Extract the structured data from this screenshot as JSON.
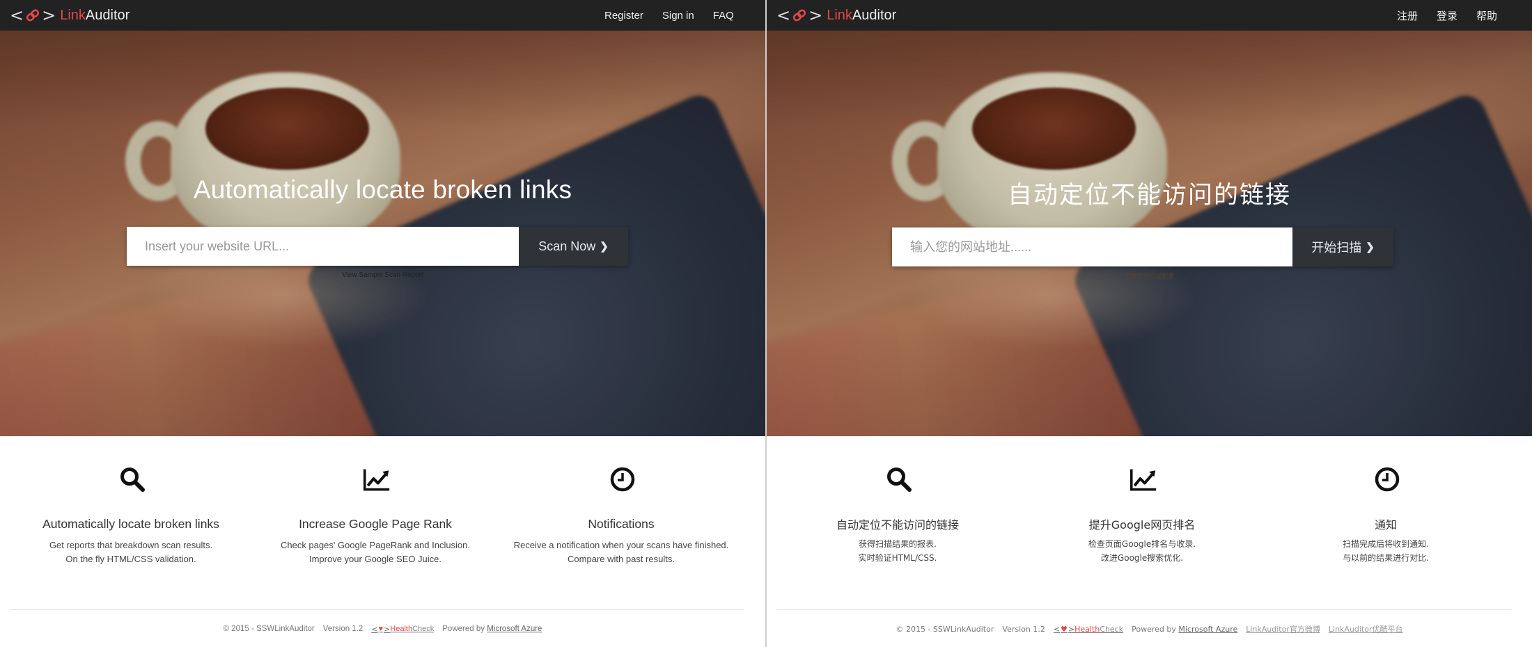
{
  "colors": {
    "brand_red": "#e2474a",
    "navbar": "#222222",
    "scan_button": "#2f3338"
  },
  "english": {
    "brand": {
      "bracket_left": "<",
      "bracket_right": ">",
      "link": "Link",
      "auditor": "Auditor",
      "icon": "chain-link-icon"
    },
    "nav": {
      "register": "Register",
      "signin": "Sign in",
      "faq": "FAQ"
    },
    "hero": {
      "headline": "Automatically locate broken links",
      "url_placeholder": "Insert your website URL...",
      "scan_label": "Scan Now",
      "scan_icon": "chevron-right-icon",
      "sample": "View Sample Scan Report"
    },
    "features": [
      {
        "icon": "search-icon",
        "title": "Automatically locate broken links",
        "line1": "Get reports that breakdown scan results.",
        "line2": "On the fly HTML/CSS validation."
      },
      {
        "icon": "line-chart-icon",
        "title": "Increase Google Page Rank",
        "line1": "Check pages' Google PageRank and Inclusion.",
        "line2": "Improve your Google SEO Juice."
      },
      {
        "icon": "clock-icon",
        "title": "Notifications",
        "line1": "Receive a notification when your scans have finished.",
        "line2": "Compare with past results."
      }
    ],
    "footer": {
      "copyright": "© 2015 - SSWLinkAuditor",
      "version": "Version 1.2",
      "healthcheck_health": "Health",
      "healthcheck_check": "Check",
      "powered": "Powered by",
      "azure": "Microsoft Azure"
    }
  },
  "chinese": {
    "brand": {
      "bracket_left": "<",
      "bracket_right": ">",
      "link": "Link",
      "auditor": "Auditor",
      "icon": "chain-link-icon"
    },
    "nav": {
      "register": "注册",
      "signin": "登录",
      "faq": "帮助"
    },
    "hero": {
      "headline": "自动定位不能访问的链接",
      "url_placeholder": "输入您的网站地址......",
      "scan_label": "开始扫描",
      "scan_icon": "chevron-right-icon",
      "sample": "查看样例扫描报表"
    },
    "features": [
      {
        "icon": "search-icon",
        "title": "自动定位不能访问的链接",
        "line1": "获得扫描结果的报表.",
        "line2": "实时验证HTML/CSS."
      },
      {
        "icon": "line-chart-icon",
        "title": "提升Google网页排名",
        "line1": "检查页面Google排名与收录.",
        "line2": "改进Google搜索优化."
      },
      {
        "icon": "clock-icon",
        "title": "通知",
        "line1": "扫描完成后将收到通知.",
        "line2": "与以前的结果进行对比."
      }
    ],
    "footer": {
      "copyright": "© 2015 - SSWLinkAuditor",
      "version": "Version 1.2",
      "healthcheck_health": "Health",
      "healthcheck_check": "Check",
      "powered": "Powered by",
      "azure": "Microsoft Azure",
      "weibo": "LinkAuditor官方微博",
      "douban": "LinkAuditor优酷平台"
    }
  }
}
